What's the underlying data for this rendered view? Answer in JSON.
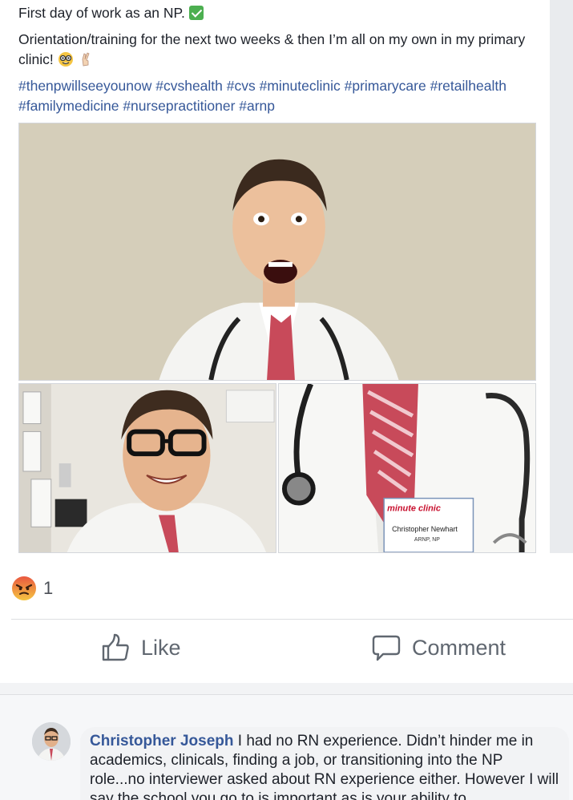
{
  "post": {
    "line1": "First day of work as an NP.",
    "line2": "Orientation/training for the next two weeks & then I’m all on my own in my primary clinic!",
    "hashtags": "#thenpwillseeyounow #cvshealth #cvs #minuteclinic #primarycare #retailhealth #familymedicine #nursepractitioner #arnp",
    "emojis": [
      "check-mark-emoji",
      "nerd-face-emoji",
      "crossed-fingers-emoji"
    ]
  },
  "photos": {
    "badge_brand": "minute clinic",
    "badge_name": "Christopher Newhart",
    "badge_title": "ARNP, NP"
  },
  "reactions": {
    "icon": "angry-face-icon",
    "count": "1"
  },
  "actions": {
    "like_label": "Like",
    "comment_label": "Comment"
  },
  "comment": {
    "author": "Christopher Joseph",
    "text": "I had no RN experience. Didn’t hinder me in academics, clinicals, finding a job, or transitioning into the NP role...no interviewer asked about RN experience either. However I will say the school you go to is important as is your ability to"
  },
  "colors": {
    "link_blue": "#365899",
    "check_green": "#4caf50",
    "angry_orange": "#f0a044",
    "tie_red": "#c84a5a"
  }
}
